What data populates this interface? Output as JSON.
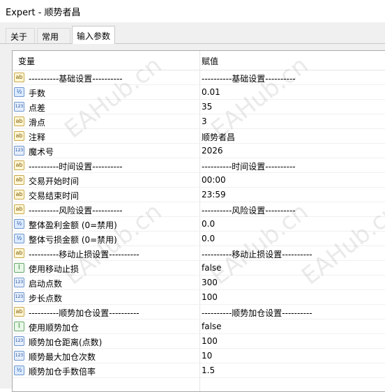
{
  "window": {
    "title": "Expert - 顺势者昌"
  },
  "tabs": [
    {
      "label": "关于",
      "active": false
    },
    {
      "label": "常用",
      "active": false
    },
    {
      "label": "输入参数",
      "active": true
    }
  ],
  "grid": {
    "headers": {
      "variable": "变量",
      "value": "赋值"
    },
    "rows": [
      {
        "icon": "string-icon",
        "name": "----------基础设置----------",
        "value": "----------基础设置----------"
      },
      {
        "icon": "double-icon",
        "name": "手数",
        "value": "0.01"
      },
      {
        "icon": "integer-icon",
        "name": "点差",
        "value": "35"
      },
      {
        "icon": "string-icon",
        "name": "滑点",
        "value": "3"
      },
      {
        "icon": "string-icon",
        "name": "注释",
        "value": "顺势者昌"
      },
      {
        "icon": "integer-icon",
        "name": "魔术号",
        "value": "2026"
      },
      {
        "icon": "string-icon",
        "name": "----------时间设置----------",
        "value": "----------时间设置----------"
      },
      {
        "icon": "string-icon",
        "name": "交易开始时间",
        "value": "00:00"
      },
      {
        "icon": "string-icon",
        "name": "交易结束时间",
        "value": "23:59"
      },
      {
        "icon": "string-icon",
        "name": "----------风险设置----------",
        "value": "----------风险设置----------"
      },
      {
        "icon": "double-icon",
        "name": "整体盈利金额 (0=禁用)",
        "value": "0.0"
      },
      {
        "icon": "double-icon",
        "name": "整体亏损金额 (0=禁用)",
        "value": "0.0"
      },
      {
        "icon": "string-icon",
        "name": "----------移动止损设置----------",
        "value": "----------移动止损设置----------"
      },
      {
        "icon": "bool-icon",
        "name": "使用移动止损",
        "value": "false"
      },
      {
        "icon": "integer-icon",
        "name": "启动点数",
        "value": "300"
      },
      {
        "icon": "integer-icon",
        "name": "步长点数",
        "value": "100"
      },
      {
        "icon": "string-icon",
        "name": "----------顺势加仓设置----------",
        "value": "----------顺势加仓设置----------"
      },
      {
        "icon": "bool-icon",
        "name": "使用顺势加仓",
        "value": "false"
      },
      {
        "icon": "integer-icon",
        "name": "顺势加仓距离(点数)",
        "value": "100"
      },
      {
        "icon": "integer-icon",
        "name": "顺势最大加仓次数",
        "value": "10"
      },
      {
        "icon": "double-icon",
        "name": "顺势加仓手数倍率",
        "value": "1.5"
      }
    ]
  },
  "watermark": "EAHub.cn",
  "icon_glyphs": {
    "string-icon": "ab",
    "double-icon": "½",
    "integer-icon": "123",
    "bool-icon": "⌇"
  }
}
